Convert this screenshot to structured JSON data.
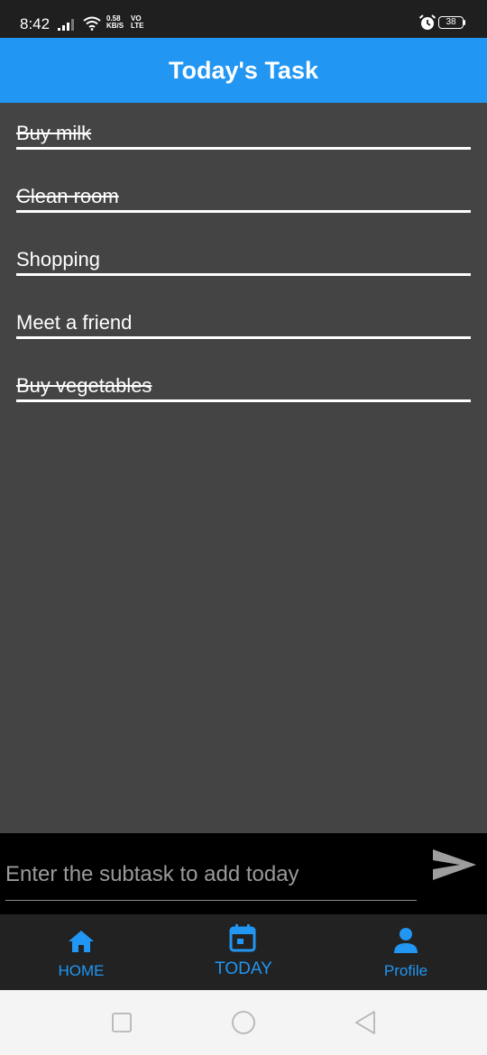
{
  "status_bar": {
    "time": "8:42",
    "speed_value": "0.58",
    "speed_unit": "KB/S",
    "net_top": "VO",
    "net_bottom": "LTE",
    "battery": "38",
    "icons": [
      "signal-icon",
      "wifi-icon",
      "alarm-icon",
      "battery-icon"
    ]
  },
  "app_bar": {
    "title": "Today's Task"
  },
  "tasks": [
    {
      "label": "Buy milk",
      "done": true
    },
    {
      "label": "Clean room",
      "done": true
    },
    {
      "label": "Shopping",
      "done": false
    },
    {
      "label": "Meet a friend",
      "done": false
    },
    {
      "label": "Buy vegetables",
      "done": true
    }
  ],
  "input": {
    "placeholder": "Enter the subtask to add today",
    "value": "",
    "send_icon": "send-icon"
  },
  "bottom_nav": {
    "items": [
      {
        "label": "HOME",
        "icon": "home-icon"
      },
      {
        "label": "TODAY",
        "icon": "calendar-icon",
        "active": true
      },
      {
        "label": "Profile",
        "icon": "person-icon"
      }
    ]
  },
  "system_nav": [
    "recent-apps-icon",
    "home-circle-icon",
    "back-icon"
  ],
  "colors": {
    "accent": "#2196f3",
    "background": "#444444",
    "input_bar": "#000000",
    "nav_bar": "#222222"
  }
}
